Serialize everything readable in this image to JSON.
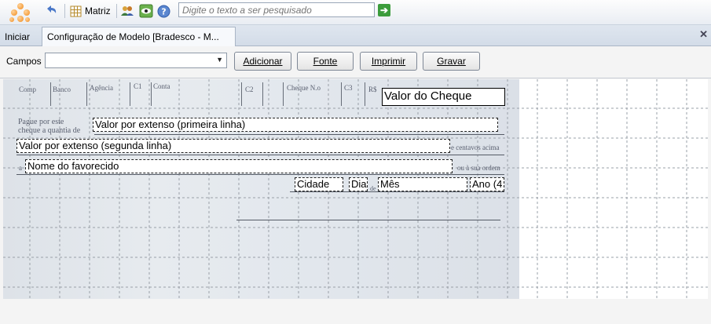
{
  "toolbar": {
    "matriz_label": "Matriz",
    "search_placeholder": "Digite o texto a ser pesquisado"
  },
  "tabs": {
    "home_label": "Iniciar",
    "active_label": "Configuração de Modelo [Bradesco - M..."
  },
  "fields_bar": {
    "campos_label": "Campos",
    "select_value": "",
    "buttons": {
      "adicionar": "Adicionar",
      "fonte": "Fonte",
      "imprimir": "Imprimir",
      "gravar": "Gravar"
    }
  },
  "cheque": {
    "printed": {
      "comp": "Comp",
      "banco": "Banco",
      "agencia": "Agência",
      "c1": "C1",
      "conta": "Conta",
      "c2": "C2",
      "cheque_no": "Cheque N.o",
      "c3": "C3",
      "rs": "R$",
      "pague_1": "Pague por este",
      "pague_2": "cheque a quantia de",
      "centavos": "e centavos acima",
      "a": "a",
      "ordem": "ou à sua ordem",
      "de": "de"
    },
    "fields": {
      "valor": "Valor do Cheque",
      "extenso_1": "Valor por extenso (primeira linha)",
      "extenso_2": "Valor por extenso (segunda linha)",
      "favorecido": "Nome do favorecido",
      "cidade": "Cidade",
      "dia": "Dia",
      "mes": "Mês",
      "ano": "Ano (4"
    }
  }
}
